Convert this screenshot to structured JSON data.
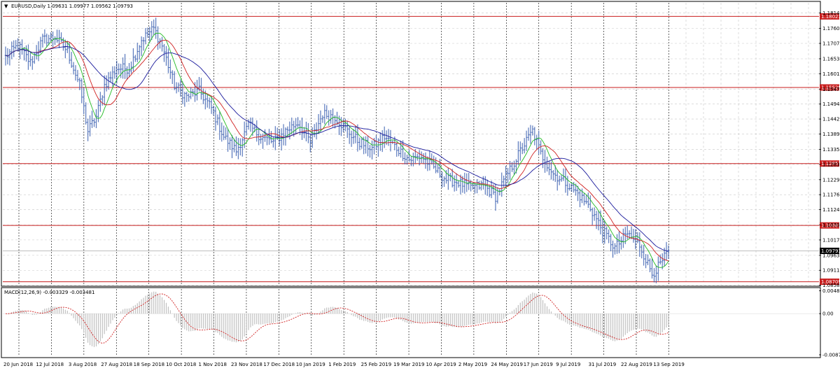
{
  "window": {
    "symbol_header": "EURUSD,Daily  1.09631 1.09977 1.09562 1.09793",
    "macd_header": "MACD(12,26,9) -0.003329 -0.003481"
  },
  "colors": {
    "background": "#ffffff",
    "bars": "#3a5fb0",
    "ma_fast": "#22bb22",
    "ma_mid": "#d02020",
    "ma_slow": "#1a1a9c",
    "level_line": "#c81e1e",
    "level_label_bg": "#c81e1e",
    "price_label_bg": "#000000",
    "macd_hist": "#b4b4b4",
    "macd_signal": "#d02020",
    "grid": "#c8c8c8"
  },
  "chart_data": {
    "type": "ohlc",
    "title": "EURUSD,Daily",
    "ohlc": {
      "open": 1.09631,
      "high": 1.09977,
      "low": 1.09562,
      "close": 1.09793
    },
    "ylim": [
      1.086,
      1.185
    ],
    "price_ticks": [
      "1.18140",
      "1.17600",
      "1.17075",
      "1.16535",
      "1.16010",
      "1.15470",
      "1.14945",
      "1.14420",
      "1.13895",
      "1.13355",
      "1.12830",
      "1.12290",
      "1.11765",
      "1.11240",
      "1.10700",
      "1.10175",
      "1.09635",
      "1.09110",
      "1.08585"
    ],
    "price_tick_values": [
      1.1814,
      1.176,
      1.17075,
      1.16535,
      1.1601,
      1.1547,
      1.14945,
      1.1442,
      1.13895,
      1.13355,
      1.1283,
      1.1229,
      1.11765,
      1.1124,
      1.107,
      1.10175,
      1.09635,
      1.0911,
      1.08585
    ],
    "levels": [
      {
        "label": "1.18023",
        "value": 1.18023
      },
      {
        "label": "1.15529",
        "value": 1.15529
      },
      {
        "label": "1.12857",
        "value": 1.12857
      },
      {
        "label": "1.10685",
        "value": 1.10685
      },
      {
        "label": "1.08709",
        "value": 1.08709
      }
    ],
    "current_price": {
      "label": "1.09793",
      "value": 1.09793
    },
    "date_labels": [
      "20 Jun 2018",
      "12 Jul 2018",
      "3 Aug 2018",
      "27 Aug 2018",
      "18 Sep 2018",
      "10 Oct 2018",
      "1 Nov 2018",
      "23 Nov 2018",
      "17 Dec 2018",
      "10 Jan 2019",
      "1 Feb 2019",
      "25 Feb 2019",
      "19 Mar 2019",
      "10 Apr 2019",
      "2 May 2019",
      "24 May 2019",
      "17 Jun 2019",
      "9 Jul 2019",
      "31 Jul 2019",
      "22 Aug 2019",
      "13 Sep 2019"
    ],
    "price_anchors": [
      [
        0,
        1.166
      ],
      [
        6,
        1.17
      ],
      [
        12,
        1.164
      ],
      [
        18,
        1.172
      ],
      [
        24,
        1.173
      ],
      [
        30,
        1.168
      ],
      [
        36,
        1.156
      ],
      [
        40,
        1.14
      ],
      [
        44,
        1.145
      ],
      [
        48,
        1.156
      ],
      [
        54,
        1.162
      ],
      [
        60,
        1.162
      ],
      [
        66,
        1.172
      ],
      [
        72,
        1.176
      ],
      [
        76,
        1.17
      ],
      [
        82,
        1.156
      ],
      [
        88,
        1.152
      ],
      [
        94,
        1.154
      ],
      [
        100,
        1.148
      ],
      [
        106,
        1.138
      ],
      [
        112,
        1.133
      ],
      [
        118,
        1.142
      ],
      [
        124,
        1.138
      ],
      [
        130,
        1.136
      ],
      [
        136,
        1.14
      ],
      [
        142,
        1.143
      ],
      [
        148,
        1.136
      ],
      [
        154,
        1.146
      ],
      [
        160,
        1.145
      ],
      [
        166,
        1.14
      ],
      [
        172,
        1.136
      ],
      [
        178,
        1.134
      ],
      [
        184,
        1.138
      ],
      [
        190,
        1.134
      ],
      [
        196,
        1.13
      ],
      [
        202,
        1.131
      ],
      [
        208,
        1.127
      ],
      [
        214,
        1.123
      ],
      [
        220,
        1.122
      ],
      [
        226,
        1.12
      ],
      [
        232,
        1.121
      ],
      [
        238,
        1.117
      ],
      [
        244,
        1.125
      ],
      [
        250,
        1.133
      ],
      [
        256,
        1.14
      ],
      [
        260,
        1.132
      ],
      [
        266,
        1.125
      ],
      [
        272,
        1.122
      ],
      [
        278,
        1.118
      ],
      [
        284,
        1.113
      ],
      [
        290,
        1.105
      ],
      [
        296,
        1.099
      ],
      [
        302,
        1.104
      ],
      [
        308,
        1.1
      ],
      [
        314,
        1.09
      ],
      [
        318,
        1.093
      ],
      [
        322,
        1.0979
      ]
    ],
    "ma_fast_offset": 0.001,
    "ma_mid_offset": 0.0025,
    "ma_slow_offset": 0.0045,
    "macd": {
      "ylim": [
        -0.009,
        0.0052
      ],
      "ticks": [
        "0.004822",
        "0.00",
        "-0.0087"
      ],
      "tick_values": [
        0.004822,
        0.0,
        -0.0087
      ],
      "current": -0.003329,
      "signal_current": -0.003481
    }
  }
}
